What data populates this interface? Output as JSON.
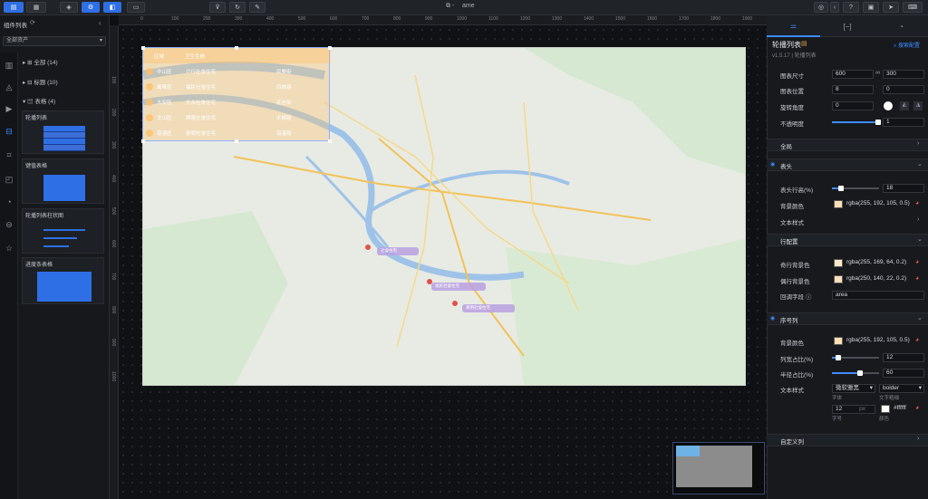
{
  "topbar": {
    "title": "ame"
  },
  "left": {
    "header": "组件列表",
    "select": "全部资产",
    "tree": [
      {
        "label": "全部 (14)"
      },
      {
        "label": "标题 (10)"
      },
      {
        "label": "表格 (4)"
      }
    ],
    "cards": [
      {
        "title": "轮播列表"
      },
      {
        "title": "键值表格"
      },
      {
        "title": "轮播列表柱状图"
      },
      {
        "title": "进度条表格"
      }
    ]
  },
  "ruler": [
    "0",
    "100",
    "200",
    "300",
    "400",
    "500",
    "600",
    "700",
    "800",
    "900",
    "1000",
    "1100",
    "1200",
    "1300",
    "1400",
    "1500",
    "1600",
    "1700",
    "1800",
    "1900"
  ],
  "vruler": [
    "100",
    "200",
    "300",
    "400",
    "500",
    "600",
    "700",
    "800",
    "900",
    "1000"
  ],
  "table": {
    "headers": [
      "区域",
      "卫生生统"
    ],
    "rows": [
      {
        "a": "中山區",
        "b": "介行社會住宅",
        "c": "民樂街"
      },
      {
        "a": "萬華區",
        "b": "福民社會住宅",
        "c": "四維路"
      },
      {
        "a": "大安區",
        "b": "光合社會住宅",
        "c": "延吉街"
      },
      {
        "a": "文山區",
        "b": "興隆社會住宅",
        "c": "木柵路"
      },
      {
        "a": "南港區",
        "b": "東明社會住宅",
        "c": "南港路"
      }
    ]
  },
  "right": {
    "tabs": [
      "属性",
      "数据",
      "交互"
    ],
    "name": "轮播列表",
    "version": "v1.5.17 | 轮播列表",
    "search": "搜索配置",
    "size_label": "图表尺寸",
    "size_w": "600",
    "size_h": "300",
    "pos_label": "图表位置",
    "pos_x": "8",
    "pos_y": "0",
    "rot_label": "旋转角度",
    "rot": "0",
    "opacity_label": "不透明度",
    "opacity": "1",
    "global": "全局",
    "header_sec": "表头",
    "header_h_label": "表头行高(%)",
    "header_h": "18",
    "bg_label": "背景颜色",
    "bg_val": "rgba(255, 192, 105, 0.5)",
    "text_style": "文本样式",
    "row_sec": "行配置",
    "odd_label": "奇行背景色",
    "odd_val": "rgba(255, 169, 64, 0.2)",
    "even_label": "偶行背景色",
    "even_val": "rgba(250, 140, 22, 0.2)",
    "field_label": "回调字段",
    "field_val": "area",
    "index_sec": "序号列",
    "ibg_label": "背景颜色",
    "ibg_val": "rgba(255, 192, 105, 0.5)",
    "colw_label": "列宽占比(%)",
    "colw": "12",
    "rad_label": "半径占比(%)",
    "rad": "60",
    "ts_label": "文本样式",
    "font": "微软雅黑",
    "weight": "bolder",
    "font_cap": "字体",
    "weight_cap": "文字粗细",
    "size": "12",
    "size_unit": "px",
    "color": "#ffffff",
    "size_cap": "字号",
    "color_cap": "颜色",
    "custom": "自定义列"
  },
  "map_labels": [
    "社會住宅",
    "福民社會住宅",
    "東明社會住宅"
  ]
}
